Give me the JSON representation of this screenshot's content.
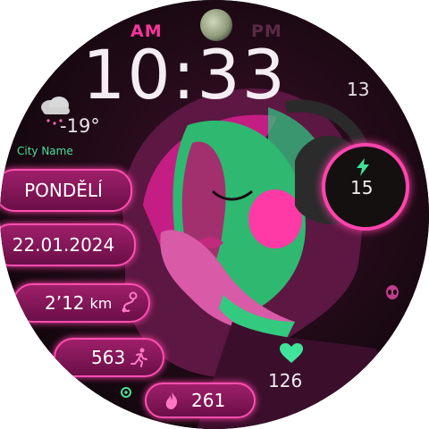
{
  "ampm": {
    "am": "AM",
    "pm": "PM"
  },
  "time": {
    "hm": "10:33",
    "seconds": "13"
  },
  "weather": {
    "icon": "cloud-snow-icon",
    "temperature": "-19°",
    "city": "City Name"
  },
  "day": {
    "name": "PONDĚLÍ"
  },
  "date": {
    "value": "22.01.2024"
  },
  "distance": {
    "value": "2’12",
    "unit": "km",
    "icon": "route-icon"
  },
  "steps": {
    "value": "563",
    "icon": "running-icon"
  },
  "calories": {
    "value": "261",
    "icon": "flame-icon"
  },
  "battery": {
    "value": "15",
    "icon": "bolt-icon"
  },
  "heart_rate": {
    "value": "126",
    "icon": "heart-icon"
  },
  "colors": {
    "accent": "#ff44ad",
    "green": "#4be09a",
    "text": "#f1ecef"
  }
}
